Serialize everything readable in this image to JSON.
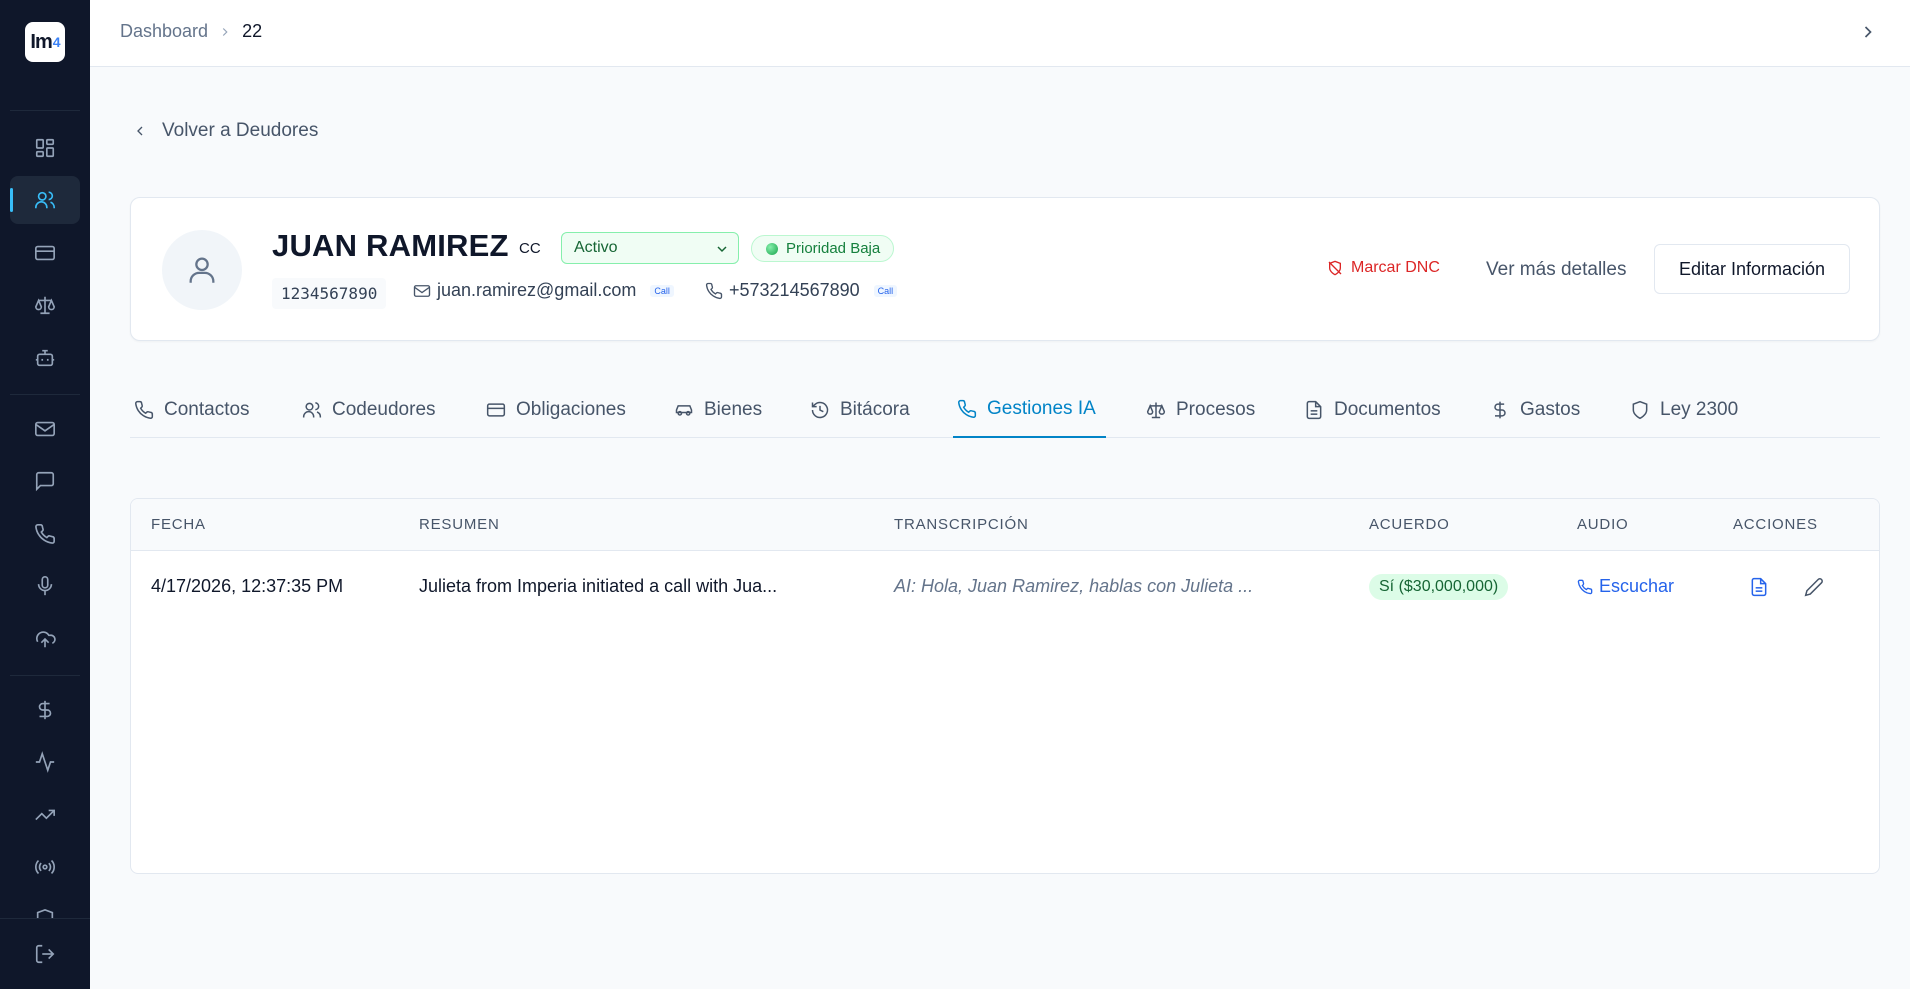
{
  "sidebar": {
    "logo_text": "Im",
    "logo_accent": "4",
    "icons": [
      "grid-icon",
      "users-icon",
      "card-icon",
      "scale-icon",
      "bot-icon",
      "mail-icon",
      "chat-icon",
      "phone-icon",
      "mic-icon",
      "upload-cloud-icon",
      "dollar-icon",
      "activity-icon",
      "trending-up-icon",
      "broadcast-icon",
      "shield-icon",
      "logout-icon"
    ]
  },
  "topbar": {
    "breadcrumb_root": "Dashboard",
    "breadcrumb_current": "22"
  },
  "back_link": "Volver a Deudores",
  "profile": {
    "name": "JUAN RAMIREZ",
    "doc_type": "CC",
    "status": "Activo",
    "priority": "Prioridad Baja",
    "id_number": "1234567890",
    "email": "juan.ramirez@gmail.com",
    "email_tag": "Call",
    "phone": "+573214567890",
    "phone_tag": "Call",
    "dnc_label": "Marcar DNC",
    "more_label": "Ver más detalles",
    "edit_label": "Editar Información"
  },
  "tabs": [
    {
      "label": "Contactos"
    },
    {
      "label": "Codeudores"
    },
    {
      "label": "Obligaciones"
    },
    {
      "label": "Bienes"
    },
    {
      "label": "Bitácora"
    },
    {
      "label": "Gestiones IA"
    },
    {
      "label": "Procesos"
    },
    {
      "label": "Documentos"
    },
    {
      "label": "Gastos"
    },
    {
      "label": "Ley 2300"
    }
  ],
  "active_tab": "Gestiones IA",
  "table": {
    "headers": [
      "Fecha",
      "Resumen",
      "Transcripción",
      "Acuerdo",
      "Audio",
      "Acciones"
    ],
    "rows": [
      {
        "fecha": "4/17/2026, 12:37:35 PM",
        "resumen": "Julieta from Imperia initiated a call with Jua...",
        "transcripcion": "AI: Hola, Juan Ramirez, hablas con Julieta ...",
        "acuerdo": "Sí ($30,000,000)",
        "audio": "Escuchar"
      }
    ]
  },
  "colors": {
    "sidebar_bg": "#0f172a",
    "accent": "#0284c7",
    "danger": "#dc2626",
    "success": "#166534"
  }
}
